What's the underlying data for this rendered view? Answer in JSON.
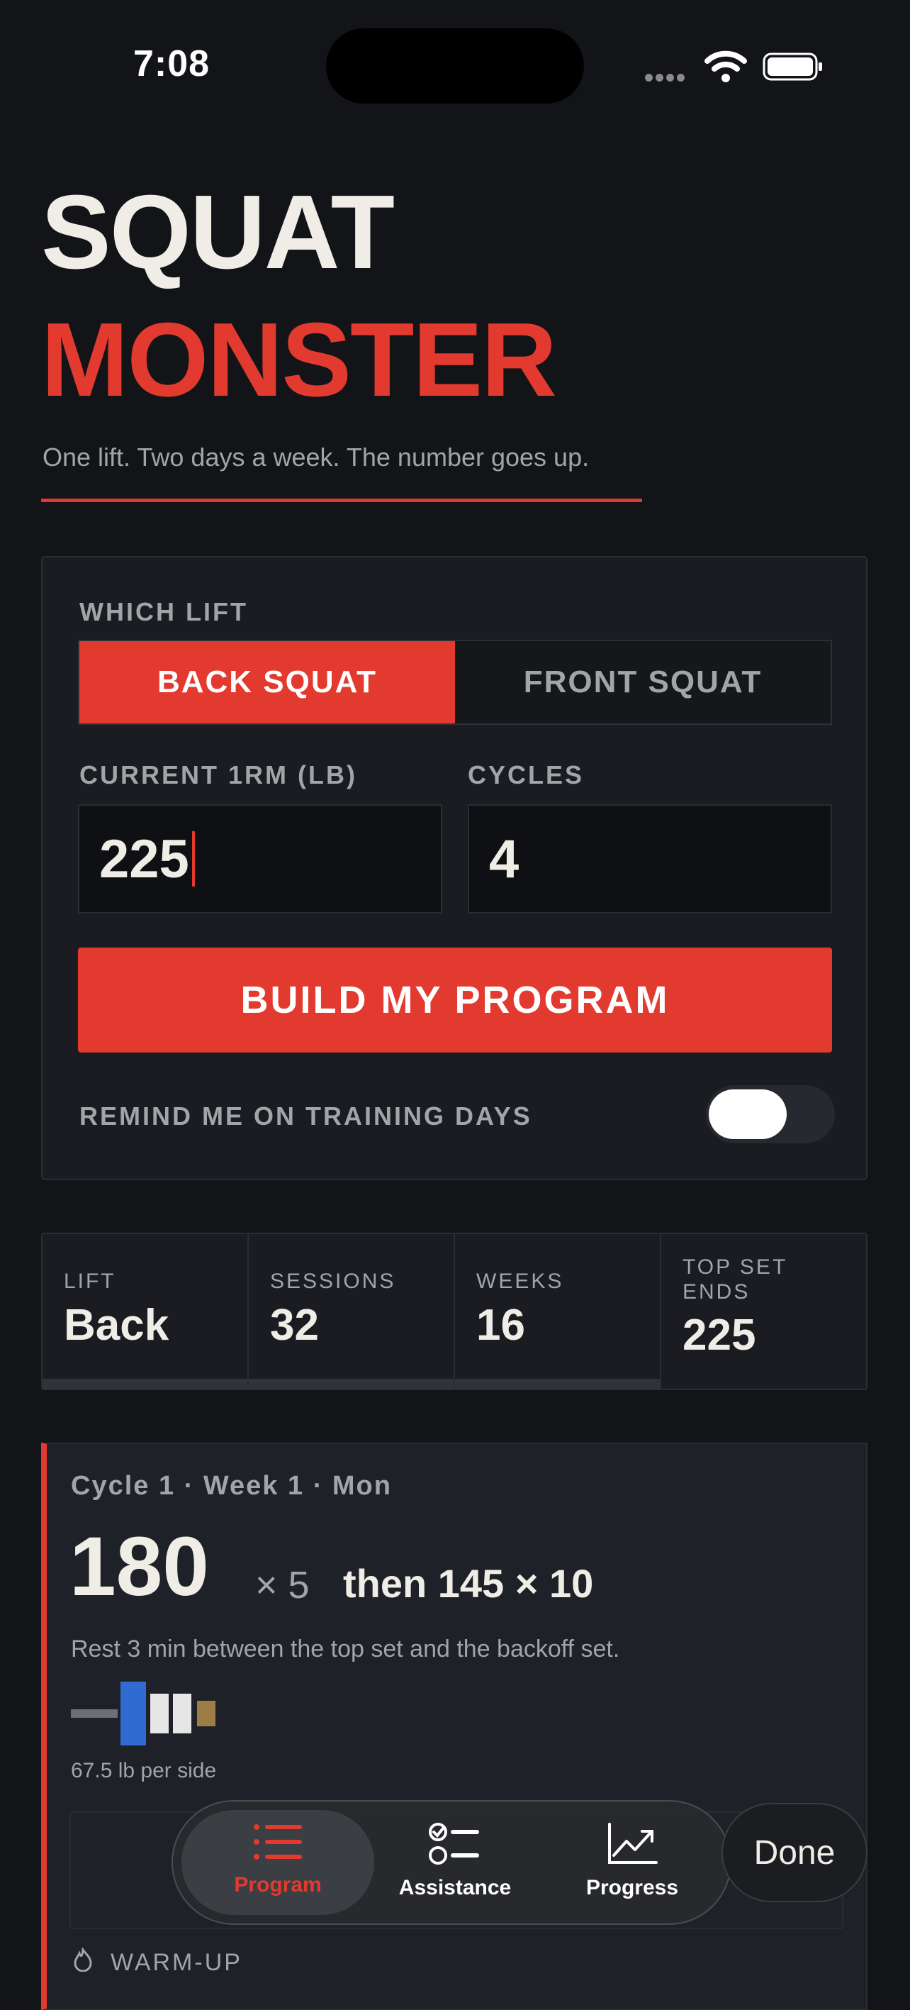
{
  "status_bar": {
    "time": "7:08"
  },
  "title": {
    "line1": "SQUAT",
    "line2": "MONSTER",
    "tagline": "One lift. Two days a week. The number goes up."
  },
  "setup": {
    "lift_label": "WHICH LIFT",
    "lift_options": [
      "BACK SQUAT",
      "FRONT SQUAT"
    ],
    "selected_lift": "BACK SQUAT",
    "one_rm_label": "CURRENT 1RM (LB)",
    "one_rm_value": "225",
    "cycles_label": "CYCLES",
    "cycles_value": "4",
    "build_button": "BUILD MY PROGRAM",
    "reminder_label": "REMIND ME ON TRAINING DAYS",
    "reminder_on": false
  },
  "stats": [
    {
      "label": "LIFT",
      "value": "Back"
    },
    {
      "label": "SESSIONS",
      "value": "32"
    },
    {
      "label": "WEEKS",
      "value": "16"
    },
    {
      "label": "TOP SET ENDS",
      "value": "225"
    }
  ],
  "session": {
    "header": "Cycle 1 · Week 1 · Mon",
    "top_weight": "180",
    "top_reps": "× 5",
    "backoff": "then 145 × 10",
    "rest_note": "Rest 3 min between the top set and the backoff set.",
    "per_side": "67.5 lb per side",
    "warmup_label": "WARM-UP",
    "plate_colors": [
      "#2f6bd0",
      "#e6e6e6",
      "#e6e6e6",
      "#9b7d45"
    ]
  },
  "tabbar": {
    "tabs": [
      {
        "label": "Program",
        "icon": "list-icon",
        "selected": true
      },
      {
        "label": "Assistance",
        "icon": "checklist-icon",
        "selected": false
      },
      {
        "label": "Progress",
        "icon": "chart-icon",
        "selected": false
      }
    ],
    "done_label": "Done"
  },
  "colors": {
    "accent": "#e33a2f",
    "background": "#121418",
    "card": "#1a1c21"
  }
}
